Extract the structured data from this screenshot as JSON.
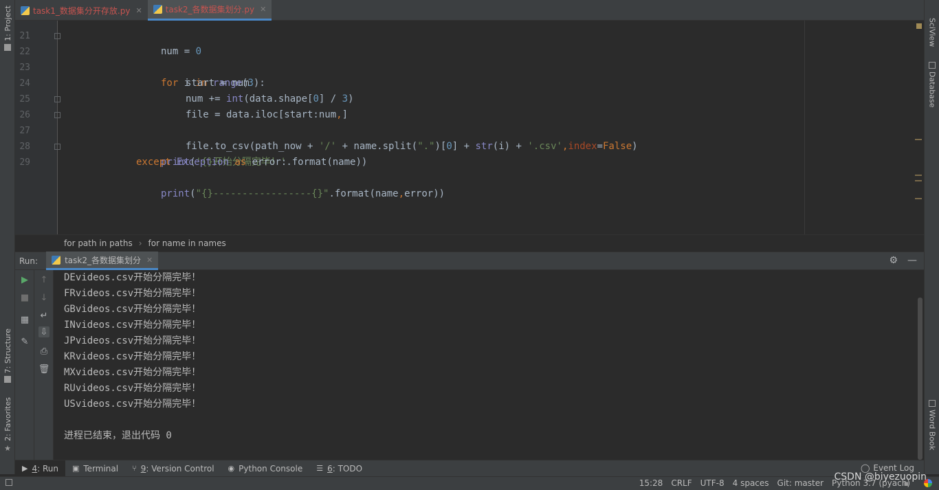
{
  "tool_windows": {
    "left": [
      {
        "label": "1: Project",
        "icon": "folder-icon"
      },
      {
        "label": "7: Structure",
        "icon": "structure-icon"
      },
      {
        "label": "2: Favorites",
        "icon": "star-icon"
      }
    ],
    "right": [
      {
        "label": "SciView",
        "icon": "sciview-icon"
      },
      {
        "label": "Database",
        "icon": "database-icon"
      },
      {
        "label": "Word Book",
        "icon": "book-icon"
      }
    ]
  },
  "tabs": [
    {
      "label": "task1_数据集分开存放.py",
      "active": false
    },
    {
      "label": "task2_各数据集划分.py",
      "active": true
    }
  ],
  "editor": {
    "lines": [
      {
        "num": "21"
      },
      {
        "num": "22"
      },
      {
        "num": "23"
      },
      {
        "num": "24"
      },
      {
        "num": "25"
      },
      {
        "num": "26"
      },
      {
        "num": "27"
      },
      {
        "num": "28"
      },
      {
        "num": "29"
      }
    ]
  },
  "breadcrumb": [
    "for path in paths",
    "for name in names"
  ],
  "run": {
    "label": "Run:",
    "tab_label": "task2_各数据集划分",
    "output": [
      "DEvideos.csv开始分隔完毕！",
      "FRvideos.csv开始分隔完毕！",
      "GBvideos.csv开始分隔完毕！",
      "INvideos.csv开始分隔完毕！",
      "JPvideos.csv开始分隔完毕！",
      "KRvideos.csv开始分隔完毕！",
      "MXvideos.csv开始分隔完毕！",
      "RUvideos.csv开始分隔完毕！",
      "USvideos.csv开始分隔完毕！",
      "",
      "进程已结束，退出代码 0"
    ]
  },
  "bottom_tools": [
    {
      "key": "4",
      "label": ": Run",
      "icon": "run-icon",
      "active": true
    },
    {
      "key": "",
      "label": "Terminal",
      "icon": "terminal-icon",
      "active": false
    },
    {
      "key": "9",
      "label": ": Version Control",
      "icon": "vcs-icon",
      "active": false
    },
    {
      "key": "",
      "label": "Python Console",
      "icon": "python-console-icon",
      "active": false
    },
    {
      "key": "6",
      "label": ": TODO",
      "icon": "todo-icon",
      "active": false
    }
  ],
  "event_log": "Event Log",
  "status": {
    "position": "15:28",
    "line_sep": "CRLF",
    "encoding": "UTF-8",
    "indent": "4 spaces",
    "git": "Git: master",
    "interpreter": "Python 3.7 (pyach)"
  },
  "watermark": "CSDN @biyezuopin",
  "colors": {
    "keyword": "#cc7832",
    "string": "#6a8759",
    "number": "#6897bb",
    "builtin": "#8888c6",
    "accent": "#4a88c7",
    "tab_text": "#c75450"
  }
}
